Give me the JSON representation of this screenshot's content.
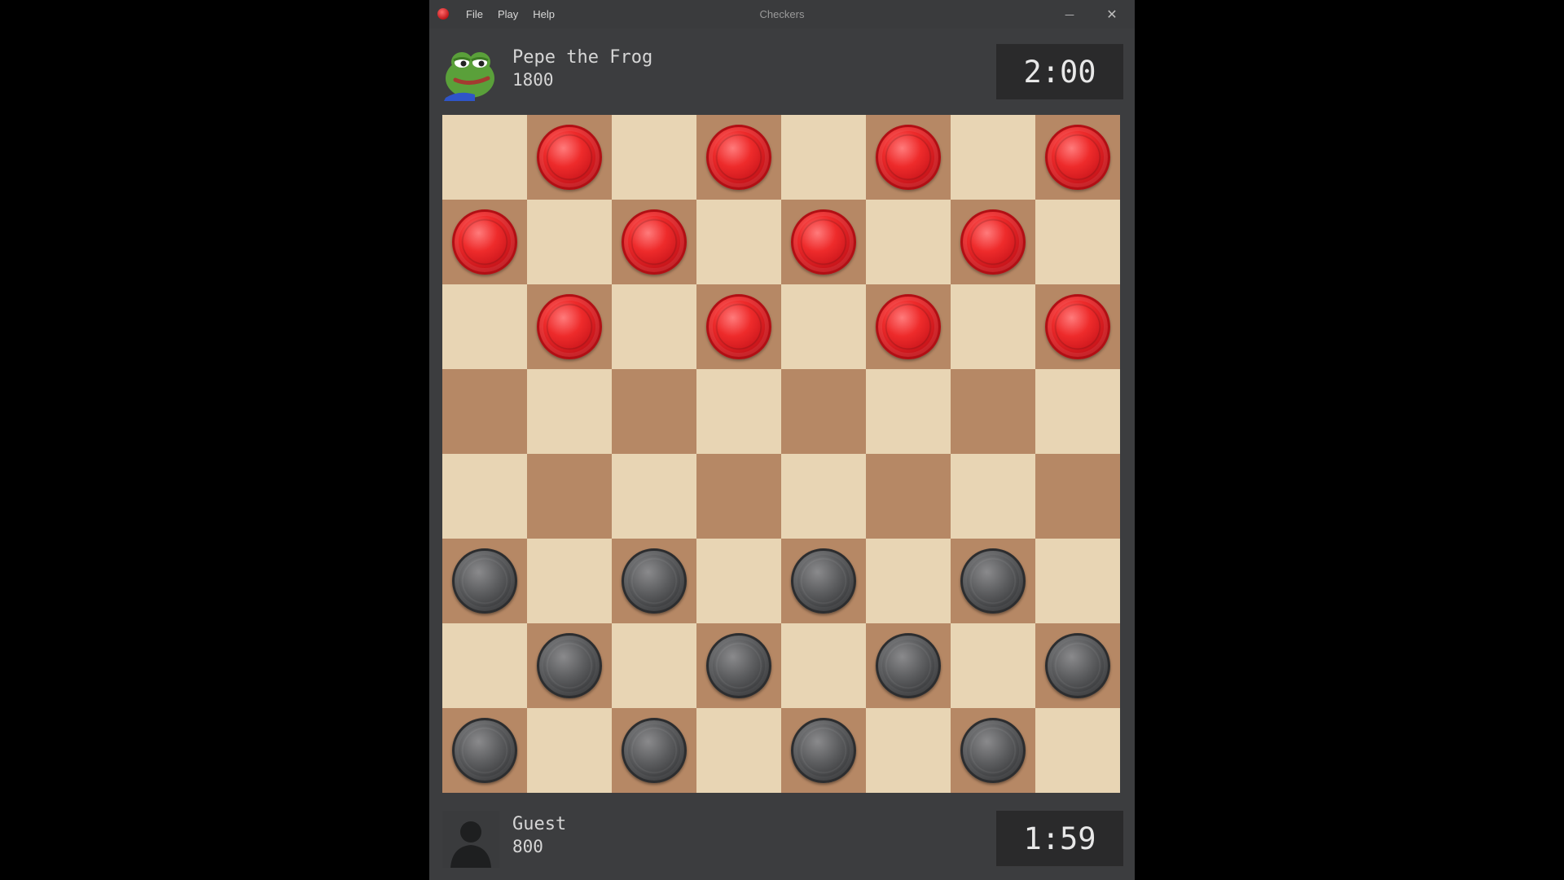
{
  "window": {
    "title": "Checkers",
    "menu": [
      "File",
      "Play",
      "Help"
    ],
    "minimize_glyph": "—",
    "close_glyph": "✕",
    "app_icon": "red-checker-icon"
  },
  "opponent": {
    "name": "Pepe the Frog",
    "rating": "1800",
    "clock": "2:00",
    "avatar": "frog-avatar"
  },
  "player": {
    "name": "Guest",
    "rating": "800",
    "clock": "1:59",
    "avatar": "silhouette-avatar"
  },
  "board": {
    "light_color": "#e8d5b4",
    "dark_color": "#b68865",
    "red_color": "#e02226",
    "black_color": "#4a4b4d",
    "rows": [
      [
        "",
        "r",
        "",
        "r",
        "",
        "r",
        "",
        "r"
      ],
      [
        "r",
        "",
        "r",
        "",
        "r",
        "",
        "r",
        ""
      ],
      [
        "",
        "r",
        "",
        "r",
        "",
        "r",
        "",
        "r"
      ],
      [
        "",
        "",
        "",
        "",
        "",
        "",
        "",
        ""
      ],
      [
        "",
        "",
        "",
        "",
        "",
        "",
        "",
        ""
      ],
      [
        "b",
        "",
        "b",
        "",
        "b",
        "",
        "b",
        ""
      ],
      [
        "",
        "b",
        "",
        "b",
        "",
        "b",
        "",
        "b"
      ],
      [
        "b",
        "",
        "b",
        "",
        "b",
        "",
        "b",
        ""
      ]
    ]
  }
}
